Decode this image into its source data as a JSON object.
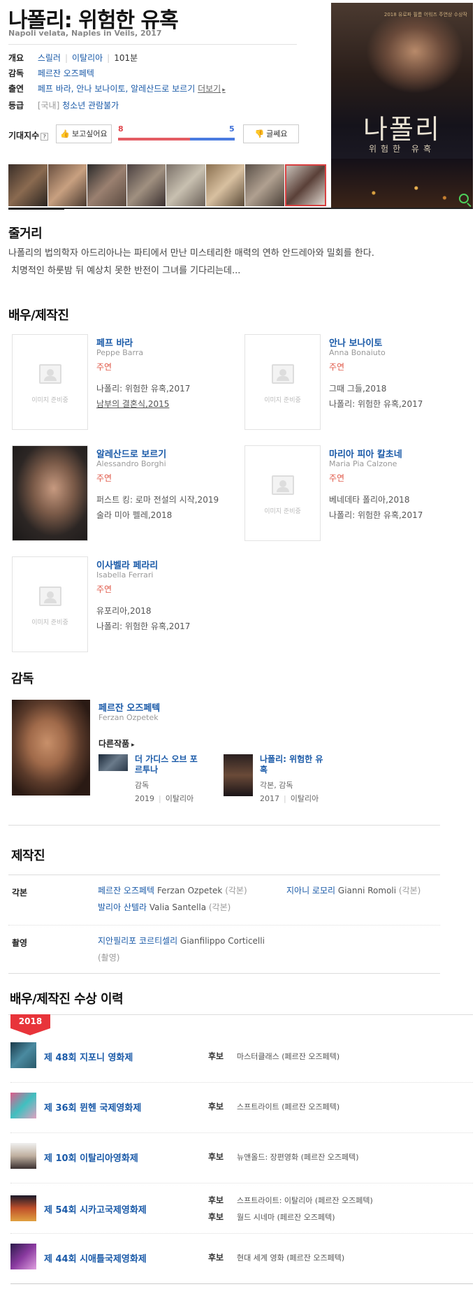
{
  "header": {
    "title": "나폴리: 위험한 유혹",
    "subtitle": "Napoli velata, Naples in Veils, 2017"
  },
  "info": {
    "overview_label": "개요",
    "genre": "스릴러",
    "country": "이탈리아",
    "runtime": "101분",
    "director_label": "감독",
    "director": "페르잔 오즈페텍",
    "cast_label": "출연",
    "cast": "페프 바라, 안나 보나이토, 알레산드로 보르기",
    "more": "더보기",
    "rating_label": "등급",
    "rating_prefix": "[국내]",
    "rating": "청소년 관람불가"
  },
  "expectation": {
    "label": "기대지수",
    "help": "?",
    "like_button": "보고싶어요",
    "dislike_button": "글쎄요",
    "like_count": "8",
    "dislike_count": "5",
    "like_ratio": 0.615
  },
  "poster": {
    "caption": "2018 유로파 필름 어워즈 주연상 수상작",
    "title": "나폴리",
    "subtitle": "위험한 유혹",
    "zoom_icon": "search-icon"
  },
  "synopsis": {
    "heading": "줄거리",
    "line1": "나폴리의 법의학자 아드리아나는 파티에서 만난 미스테리한 매력의 연하 안드레아와 밀회를 한다.",
    "line2": "치명적인 하룻밤 뒤 예상치 못한 반전이 그녀를 기다리는데..."
  },
  "cast_section": {
    "heading": "배우/제작진",
    "placeholder_text": "이미지 준비중",
    "members": [
      {
        "name": "페프 바라",
        "en": "Peppe Barra",
        "role": "주연",
        "works": [
          "나폴리: 위험한 유혹,2017",
          "남부의 결혼식,2015"
        ]
      },
      {
        "name": "안나 보나이토",
        "en": "Anna Bonaiuto",
        "role": "주연",
        "works": [
          "그때 그들,2018",
          "나폴리: 위험한 유혹,2017"
        ]
      },
      {
        "name": "알레산드로 보르기",
        "en": "Alessandro Borghi",
        "role": "주연",
        "works": [
          "퍼스트 킹: 로마 전설의 시작,2019",
          "술라 미아 펠레,2018"
        ]
      },
      {
        "name": "마리아 피아 칼초네",
        "en": "Maria Pia Calzone",
        "role": "주연",
        "works": [
          "베네데타 폴리아,2018",
          "나폴리: 위험한 유혹,2017"
        ]
      },
      {
        "name": "이사벨라 페라리",
        "en": "Isabella Ferrari",
        "role": "주연",
        "works": [
          "유포리아,2018",
          "나폴리: 위험한 유혹,2017"
        ]
      }
    ]
  },
  "director_section": {
    "heading": "감독",
    "name": "페르잔 오즈페텍",
    "en": "Ferzan Ozpetek",
    "other_label": "다른작품",
    "works": [
      {
        "title1": "더 가디스 오브 포",
        "title2": "르투나",
        "role": "감독",
        "year": "2019",
        "country": "이탈리아"
      },
      {
        "title1": "나폴리: 위험한 유",
        "title2": "혹",
        "role": "각본, 감독",
        "year": "2017",
        "country": "이탈리아"
      }
    ]
  },
  "crew_section": {
    "heading": "제작진",
    "writer_label": "각본",
    "writers": [
      {
        "ko": "페르잔 오즈페텍",
        "en": "Ferzan Ozpetek",
        "tag": "(각본)"
      },
      {
        "ko": "지아니 로모리",
        "en": "Gianni Romoli",
        "tag": "(각본)"
      },
      {
        "ko": "발리아 산텔라",
        "en": "Valia Santella",
        "tag": "(각본)"
      }
    ],
    "camera_label": "촬영",
    "camera": {
      "ko": "지안필리포 코르티셀리",
      "en": "Gianfilippo Corticelli",
      "tag": "(촬영)"
    }
  },
  "awards_section": {
    "heading": "배우/제작진 수상 이력",
    "year": "2018",
    "awards": [
      {
        "name": "제 48회 지포니 영화제",
        "entries": [
          {
            "type": "후보",
            "category": "마스터클래스 (페르잔 오즈페텍)"
          }
        ]
      },
      {
        "name": "제 36회 뮌헨 국제영화제",
        "entries": [
          {
            "type": "후보",
            "category": "스프트라이트 (페르잔 오즈페텍)"
          }
        ]
      },
      {
        "name": "제 10회 이탈리아영화제",
        "entries": [
          {
            "type": "후보",
            "category": "뉴앤올드: 장편영화 (페르잔 오즈페텍)"
          }
        ]
      },
      {
        "name": "제 54회 시카고국제영화제",
        "entries": [
          {
            "type": "후보",
            "category": "스프트라이트: 이탈리아 (페르잔 오즈페텍)"
          },
          {
            "type": "후보",
            "category": "월드 시네마 (페르잔 오즈페텍)"
          }
        ]
      },
      {
        "name": "제 44회 시애틀국제영화제",
        "entries": [
          {
            "type": "후보",
            "category": "현대 세계 영화 (페르잔 오즈페텍)"
          }
        ]
      }
    ]
  },
  "colors": {
    "accent_blue": "#1a5aa8",
    "like_red": "#e45c63",
    "dislike_blue": "#4a7be0",
    "role_red": "#e05a4a",
    "badge_red": "#e8343a"
  }
}
